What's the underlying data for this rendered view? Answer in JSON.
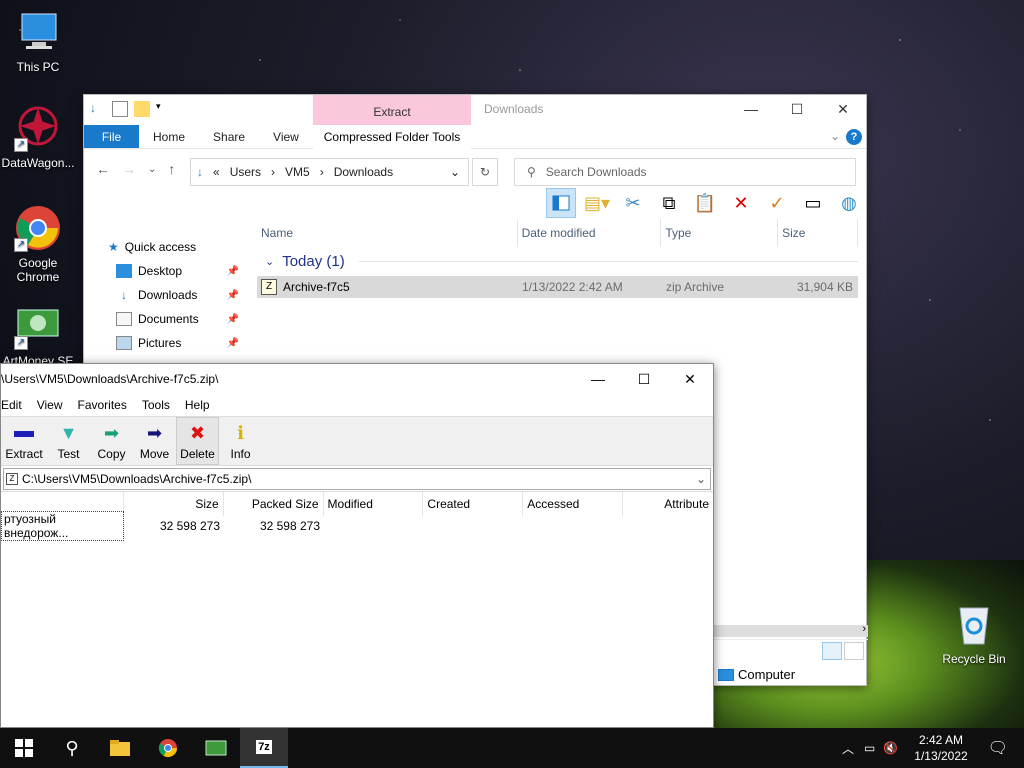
{
  "desktop": {
    "icons": [
      {
        "label": "This PC"
      },
      {
        "label": "DataWagon..."
      },
      {
        "label": "Google Chrome"
      },
      {
        "label": "ArtMoney SE"
      },
      {
        "label": "Recycle Bin"
      }
    ]
  },
  "explorer": {
    "title": "Downloads",
    "context_tab": "Extract",
    "context_label": "Compressed Folder Tools",
    "ribbon_tabs": [
      "File",
      "Home",
      "Share",
      "View"
    ],
    "breadcrumb": [
      "Users",
      "VM5",
      "Downloads"
    ],
    "breadcrumb_prefix": "«",
    "search_placeholder": "Search Downloads",
    "nav_pane": {
      "quick_access": "Quick access",
      "items": [
        "Desktop",
        "Downloads",
        "Documents",
        "Pictures"
      ]
    },
    "columns": [
      "Name",
      "Date modified",
      "Type",
      "Size"
    ],
    "group": "Today (1)",
    "files": [
      {
        "name": "Archive-f7c5",
        "date": "1/13/2022 2:42 AM",
        "type": "zip Archive",
        "size": "31,904 KB"
      }
    ],
    "status_item": "Computer"
  },
  "sevenzip": {
    "title": "\\Users\\VM5\\Downloads\\Archive-f7c5.zip\\",
    "menu": [
      "Edit",
      "View",
      "Favorites",
      "Tools",
      "Help"
    ],
    "tools": [
      "Extract",
      "Test",
      "Copy",
      "Move",
      "Delete",
      "Info"
    ],
    "path": "C:\\Users\\VM5\\Downloads\\Archive-f7c5.zip\\",
    "columns": [
      "Size",
      "Packed Size",
      "Modified",
      "Created",
      "Accessed",
      "Attribute"
    ],
    "rows": [
      {
        "name": "ртуозный внедорож...",
        "size": "32 598 273",
        "packed": "32 598 273"
      }
    ]
  },
  "taskbar": {
    "time": "2:42 AM",
    "date": "1/13/2022"
  }
}
